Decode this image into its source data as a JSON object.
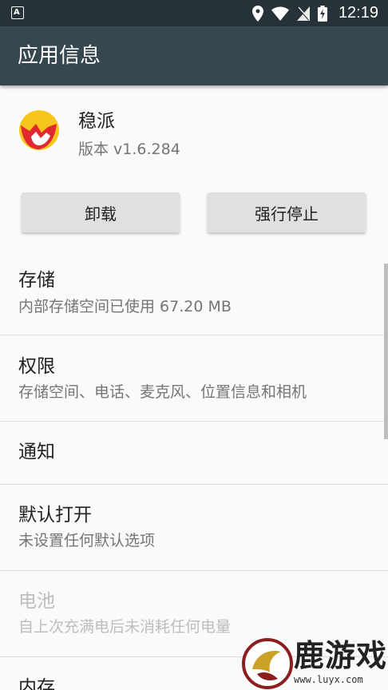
{
  "status_bar": {
    "notification_icon_letter": "A",
    "icons": [
      "location-icon",
      "wifi-icon",
      "no-sim-icon",
      "battery-charging-icon"
    ],
    "time": "12:19"
  },
  "app_bar": {
    "title": "应用信息"
  },
  "app": {
    "name": "稳派",
    "version": "版本 v1.6.284",
    "icon_colors": {
      "yellow": "#f7c51e",
      "red": "#e0282f"
    }
  },
  "buttons": {
    "uninstall": "卸载",
    "force_stop": "强行停止"
  },
  "settings": [
    {
      "title": "存储",
      "subtitle": "内部存储空间已使用 67.20 MB",
      "enabled": true
    },
    {
      "title": "权限",
      "subtitle": "存储空间、电话、麦克风、位置信息和相机",
      "enabled": true
    },
    {
      "title": "通知",
      "subtitle": "",
      "enabled": true
    },
    {
      "title": "默认打开",
      "subtitle": "未设置任何默认选项",
      "enabled": true
    },
    {
      "title": "电池",
      "subtitle": "自上次充满电后未消耗任何电量",
      "enabled": false
    },
    {
      "title": "内存",
      "subtitle": "",
      "enabled": true
    }
  ],
  "watermark": {
    "text": "鹿游戏",
    "url": "www.luyx.com"
  }
}
